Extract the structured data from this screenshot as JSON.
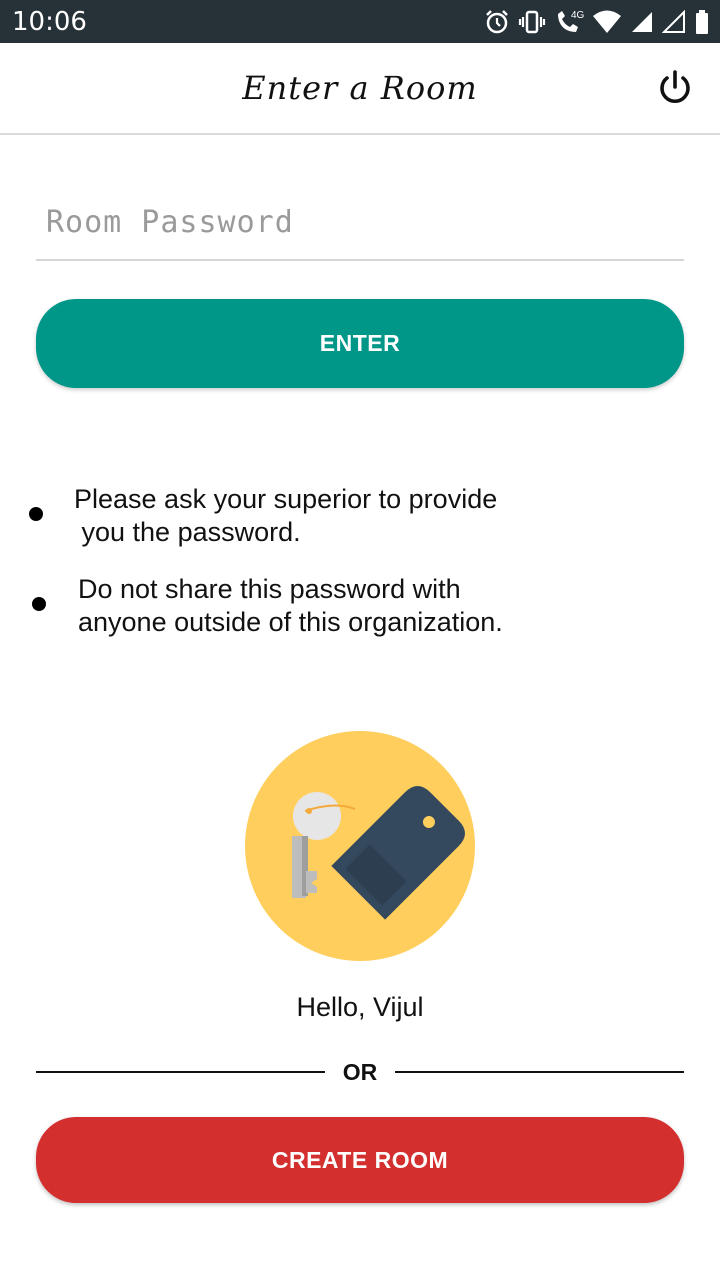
{
  "status_bar": {
    "time": "10:06",
    "network_label": "4G",
    "icons": [
      "alarm-icon",
      "vibrate-icon",
      "volte-call-icon",
      "wifi-icon",
      "signal-icon",
      "signal-empty-icon",
      "battery-icon"
    ]
  },
  "app_bar": {
    "title": "Enter a Room",
    "action_icon": "power-icon"
  },
  "password_input": {
    "placeholder": "Room Password",
    "value": ""
  },
  "enter_button": {
    "label": "ENTER"
  },
  "notes": [
    {
      "line1": "Please ask your superior to provide",
      "line2": " you the password."
    },
    {
      "line1": "Do not share this password with",
      "line2": "anyone outside of this organization."
    }
  ],
  "illustration": {
    "icon": "key-icon"
  },
  "greeting": "Hello, Vijul",
  "divider": {
    "label": "OR"
  },
  "create_button": {
    "label": "CREATE ROOM"
  },
  "colors": {
    "status_bar": "#263238",
    "primary": "#009688",
    "danger": "#d32f2f",
    "illustration_bg": "#ffce5c",
    "key_tag": "#34495e"
  }
}
